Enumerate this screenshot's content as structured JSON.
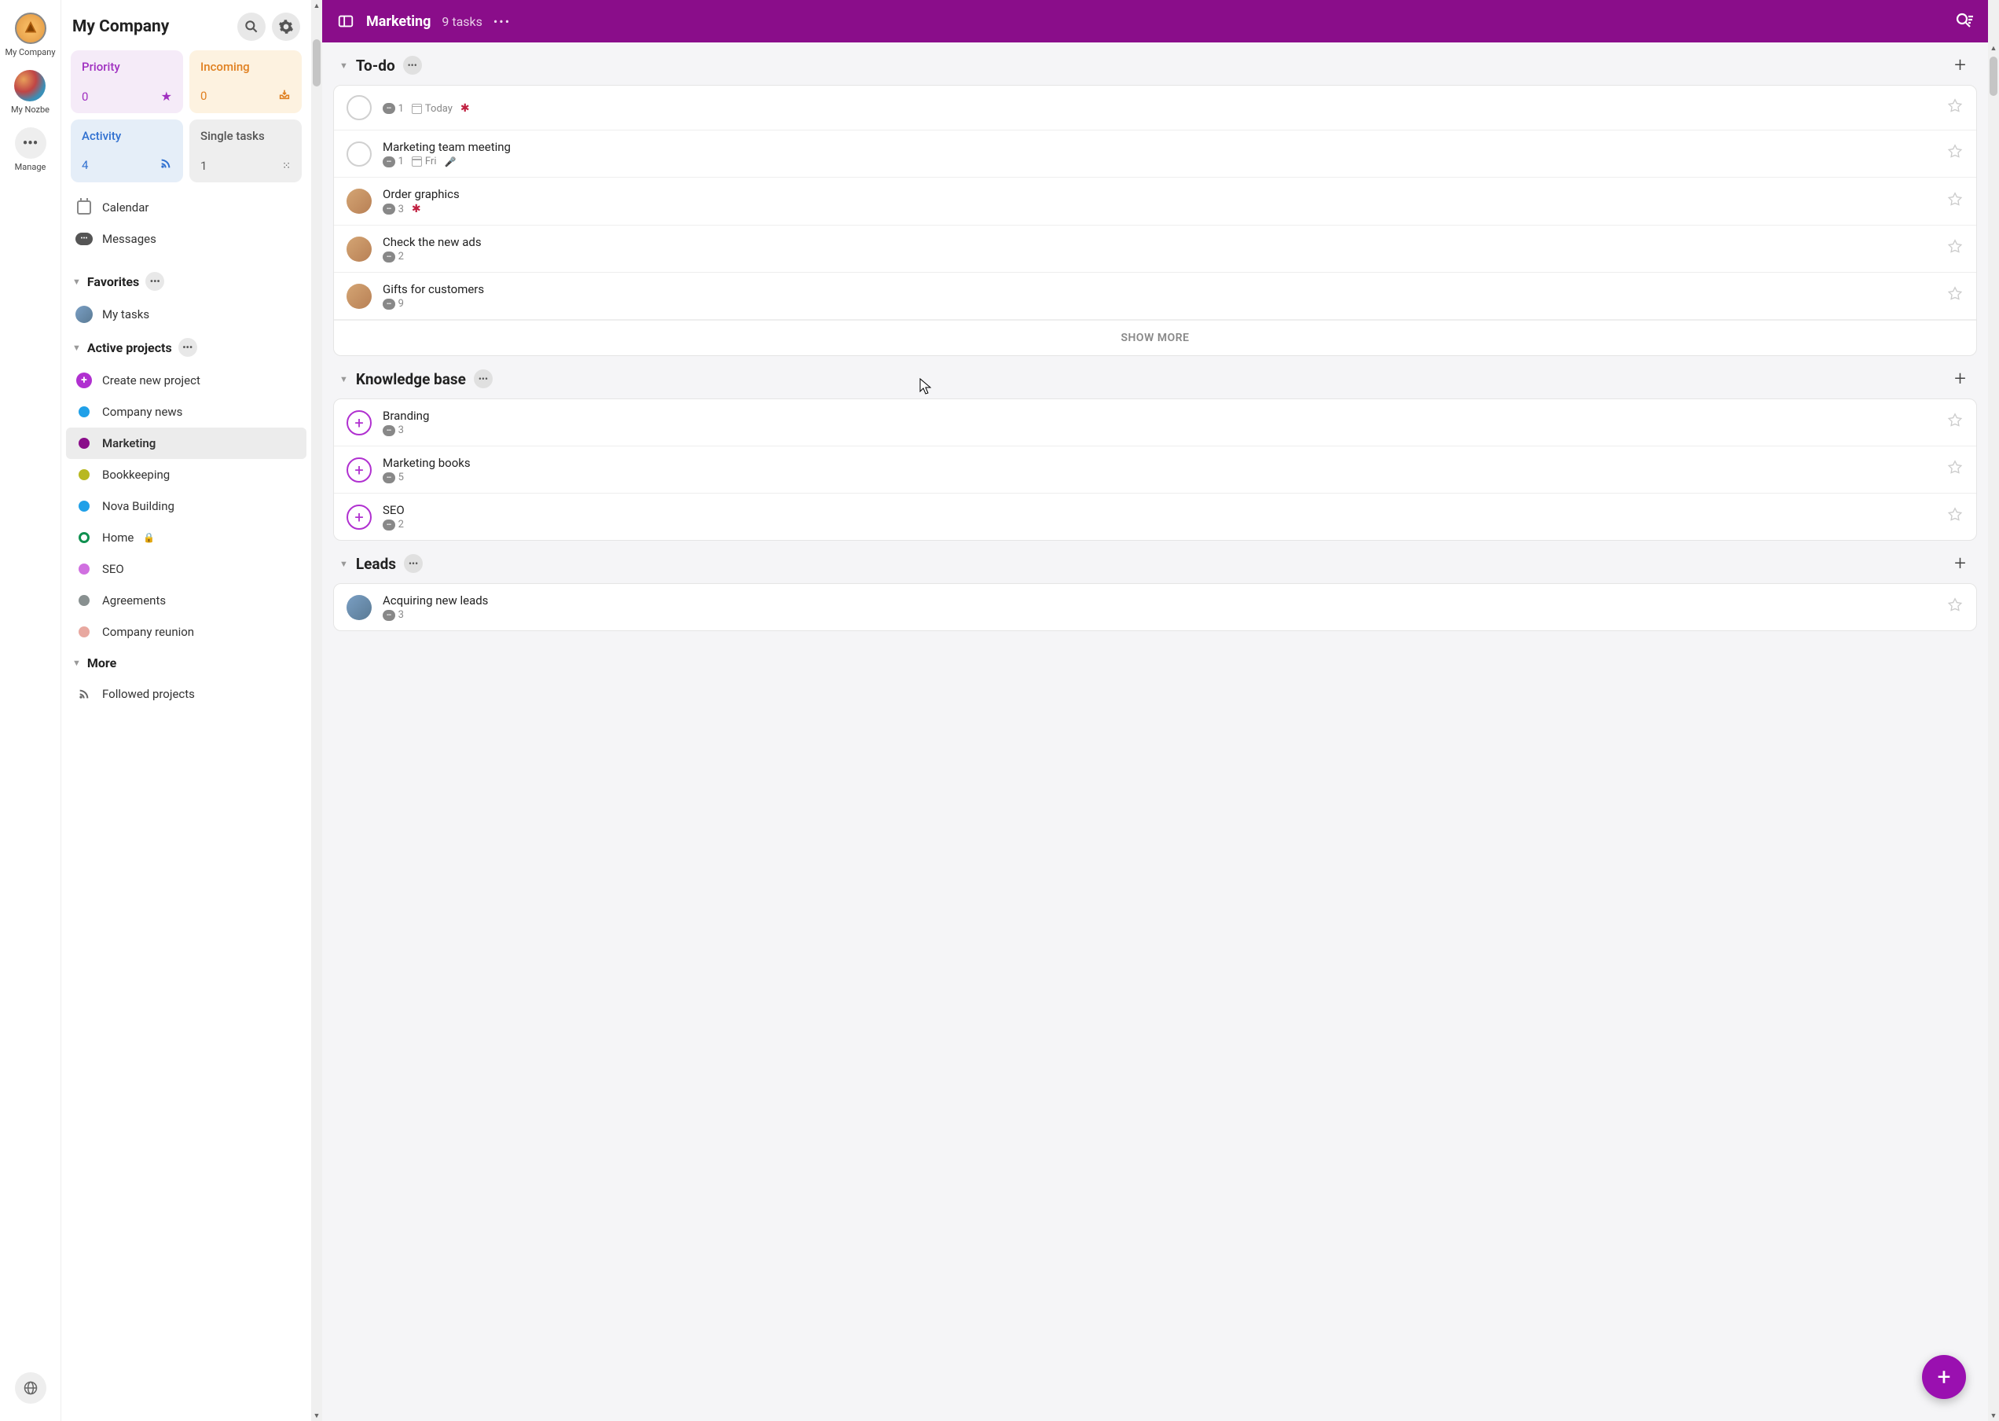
{
  "rail": {
    "company": "My Company",
    "nozbe": "My Nozbe",
    "manage": "Manage"
  },
  "sidebar": {
    "title": "My Company",
    "tiles": {
      "priority": {
        "label": "Priority",
        "count": "0"
      },
      "incoming": {
        "label": "Incoming",
        "count": "0"
      },
      "activity": {
        "label": "Activity",
        "count": "4"
      },
      "single": {
        "label": "Single tasks",
        "count": "1"
      }
    },
    "calendar": "Calendar",
    "messages": "Messages",
    "favorites_label": "Favorites",
    "my_tasks": "My tasks",
    "active_projects_label": "Active projects",
    "create_project": "Create new project",
    "projects": [
      {
        "name": "Company news",
        "color": "#20a0e8"
      },
      {
        "name": "Marketing",
        "color": "#8a0d8a",
        "active": true
      },
      {
        "name": "Bookkeeping",
        "color": "#b8b820"
      },
      {
        "name": "Nova Building",
        "color": "#20a0e8"
      },
      {
        "name": "Home",
        "color": "#109050",
        "locked": true
      },
      {
        "name": "SEO",
        "color": "#d070e0"
      },
      {
        "name": "Agreements",
        "color": "#889090"
      },
      {
        "name": "Company reunion",
        "color": "#e8a8a0"
      }
    ],
    "more_label": "More",
    "followed_projects": "Followed projects"
  },
  "header": {
    "title": "Marketing",
    "subtitle": "9 tasks"
  },
  "groups": {
    "todo": {
      "title": "To-do",
      "tasks": [
        {
          "title": "",
          "comments": "1",
          "date": "Today",
          "starred": true,
          "check": true
        },
        {
          "title": "Marketing team meeting",
          "comments": "1",
          "date": "Fri",
          "mic": true,
          "check": true
        },
        {
          "title": "Order graphics",
          "comments": "3",
          "starred": true,
          "avatar": "f1"
        },
        {
          "title": "Check the new ads",
          "comments": "2",
          "avatar": "f1"
        },
        {
          "title": "Gifts for customers",
          "comments": "9",
          "avatar": "f1"
        }
      ],
      "show_more": "SHOW MORE"
    },
    "knowledge": {
      "title": "Knowledge base",
      "tasks": [
        {
          "title": "Branding",
          "comments": "3",
          "plus": true
        },
        {
          "title": "Marketing books",
          "comments": "5",
          "plus": true
        },
        {
          "title": "SEO",
          "comments": "2",
          "plus": true
        }
      ]
    },
    "leads": {
      "title": "Leads",
      "tasks": [
        {
          "title": "Acquiring new leads",
          "comments": "3",
          "avatar": "m1"
        }
      ]
    }
  }
}
